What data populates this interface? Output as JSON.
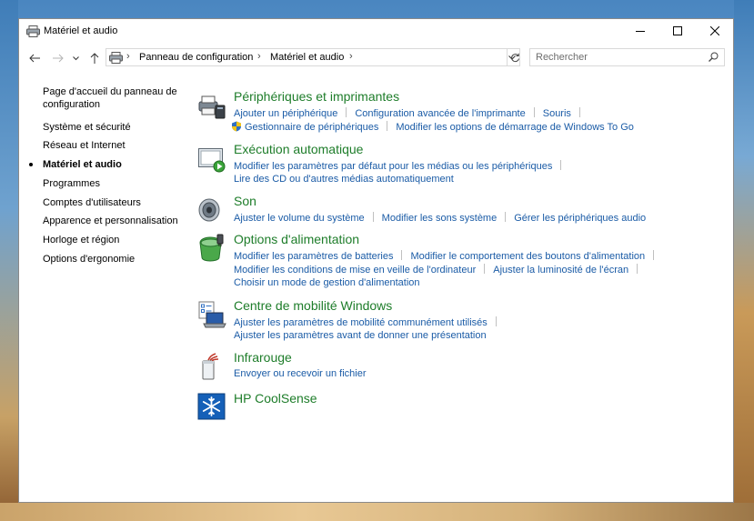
{
  "window": {
    "title": "Matériel et audio"
  },
  "address": {
    "crumbs": [
      "Panneau de configuration",
      "Matériel et audio"
    ]
  },
  "search": {
    "placeholder": "Rechercher"
  },
  "sidebar": {
    "items": [
      {
        "label": "Page d'accueil du panneau de configuration"
      },
      {
        "label": "Système et sécurité"
      },
      {
        "label": "Réseau et Internet"
      },
      {
        "label": "Matériel et audio",
        "current": true
      },
      {
        "label": "Programmes"
      },
      {
        "label": "Comptes d'utilisateurs"
      },
      {
        "label": "Apparence et personnalisation"
      },
      {
        "label": "Horloge et région"
      },
      {
        "label": "Options d'ergonomie"
      }
    ]
  },
  "categories": [
    {
      "title": "Périphériques et imprimantes",
      "icon": "printer-icon",
      "lines": [
        [
          "Ajouter un périphérique",
          "Configuration avancée de l'imprimante",
          "Souris"
        ],
        [
          "Gestionnaire de périphériques",
          "Modifier les options de démarrage de Windows To Go"
        ]
      ]
    },
    {
      "title": "Exécution automatique",
      "icon": "autoplay-icon",
      "lines": [
        [
          "Modifier les paramètres par défaut pour les médias ou les périphériques"
        ],
        [
          "Lire des CD ou d'autres médias automatiquement"
        ]
      ]
    },
    {
      "title": "Son",
      "icon": "speaker-icon",
      "lines": [
        [
          "Ajuster le volume du système",
          "Modifier les sons système",
          "Gérer les périphériques audio"
        ]
      ]
    },
    {
      "title": "Options d'alimentation",
      "icon": "power-options-icon",
      "lines": [
        [
          "Modifier les paramètres de batteries",
          "Modifier le comportement des boutons d'alimentation"
        ],
        [
          "Modifier les conditions de mise en veille de l'ordinateur",
          "Ajuster la luminosité de l'écran"
        ],
        [
          "Choisir un mode de gestion d'alimentation"
        ]
      ]
    },
    {
      "title": "Centre de mobilité Windows",
      "icon": "mobility-center-icon",
      "lines": [
        [
          "Ajuster les paramètres de mobilité communément utilisés"
        ],
        [
          "Ajuster les paramètres avant de donner une présentation"
        ]
      ]
    },
    {
      "title": "Infrarouge",
      "icon": "infrared-icon",
      "lines": [
        [
          "Envoyer ou recevoir un fichier"
        ]
      ]
    },
    {
      "title": "HP CoolSense",
      "icon": "snowflake-icon",
      "lines": []
    }
  ],
  "colors": {
    "category_title": "#1e7d2a",
    "link": "#1a5ba6"
  }
}
